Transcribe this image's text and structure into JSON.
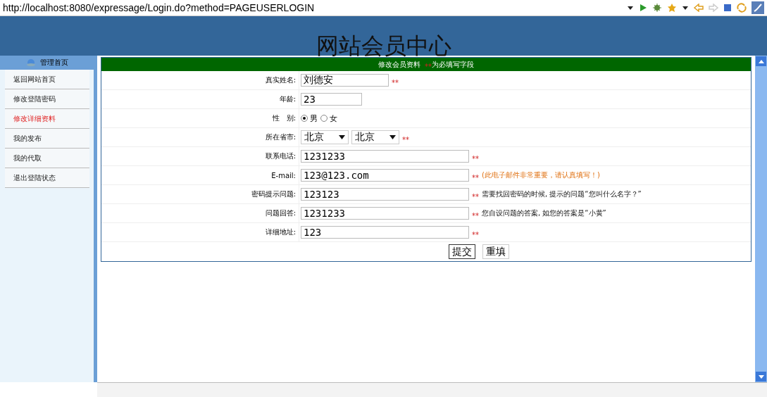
{
  "address_bar": {
    "url": "http://localhost:8080/expressage/Login.do?method=PAGEUSERLOGIN"
  },
  "header": {
    "title": "网站会员中心"
  },
  "sidebar": {
    "title": "管理首页",
    "items": [
      {
        "label": "返回网站首页",
        "selected": false
      },
      {
        "label": "修改登陆密码",
        "selected": false
      },
      {
        "label": "修改详细资料",
        "selected": true
      },
      {
        "label": "我的发布",
        "selected": false
      },
      {
        "label": "我的代取",
        "selected": false
      },
      {
        "label": "退出登陆状态",
        "selected": false
      }
    ]
  },
  "form": {
    "title": "修改会员资料",
    "required_mark": "**",
    "required_note": "为必填写字段",
    "rows": [
      {
        "kind": "text",
        "label": "真实姓名:",
        "value": "刘德安",
        "required": true
      },
      {
        "kind": "text",
        "label": "年龄:",
        "value": "23",
        "required": false
      },
      {
        "kind": "radio",
        "label": "性　别:",
        "options": [
          {
            "label": "男",
            "selected": true
          },
          {
            "label": "女",
            "selected": false
          }
        ],
        "required": false
      },
      {
        "kind": "select",
        "label": "所在省市:",
        "selects": [
          "北京",
          "北京"
        ],
        "required": true
      },
      {
        "kind": "text",
        "label": "联系电话:",
        "value": "1231233",
        "required": true
      },
      {
        "kind": "text",
        "label": "E-mail:",
        "value": "123@123.com",
        "required": true,
        "note": "(此电子邮件非常重要，请认真填写！)",
        "note_warning": true
      },
      {
        "kind": "text",
        "label": "密码提示问题:",
        "value": "123123",
        "required": true,
        "note": "需要找回密码的时候, 提示的问题“您叫什么名字？”",
        "note_warning": false
      },
      {
        "kind": "text",
        "label": "问题回答:",
        "value": "1231233",
        "required": true,
        "note": "您自设问题的答案, 如您的答案是“小黄”",
        "note_warning": false
      },
      {
        "kind": "text",
        "label": "详细地址:",
        "value": "123",
        "required": true
      }
    ],
    "buttons": [
      "提交",
      "重填"
    ]
  }
}
